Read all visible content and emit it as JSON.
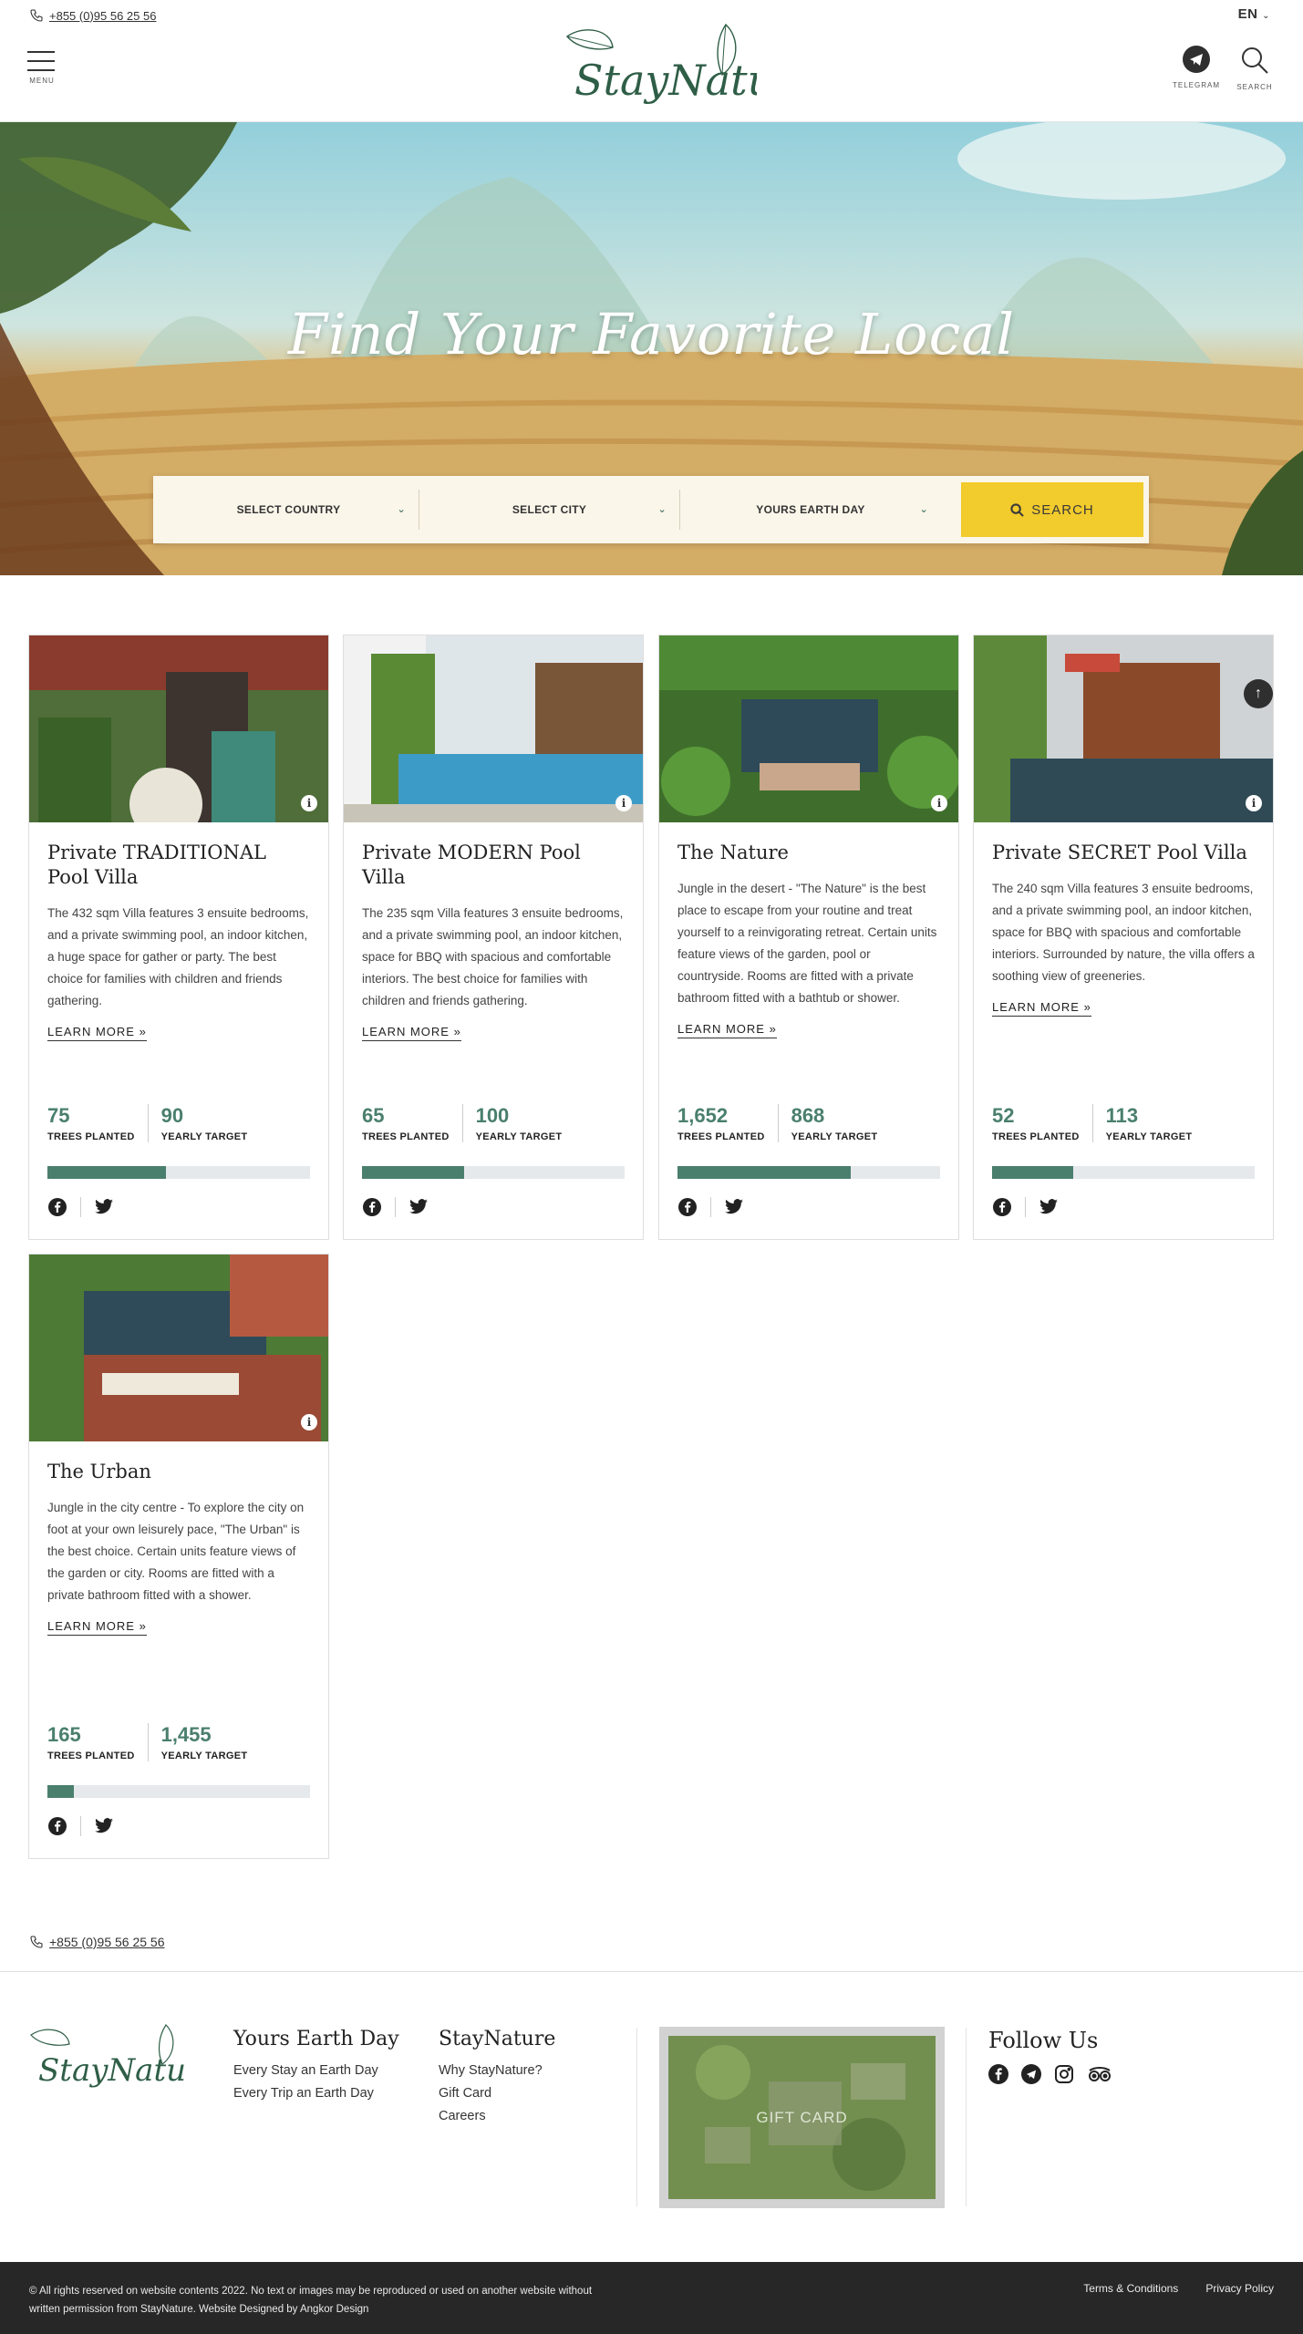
{
  "header": {
    "phone": "+855 (0)95 56 25 56",
    "language": "EN",
    "menu_label": "MENU",
    "telegram_label": "TELEGRAM",
    "search_label": "SEARCH",
    "logo_text": "StayNature"
  },
  "hero": {
    "title": "Find Your Favorite Local",
    "select_country": "SELECT COUNTRY",
    "select_city": "SELECT CITY",
    "select_day": "YOURS EARTH DAY",
    "search_button": "SEARCH"
  },
  "cards": [
    {
      "title": "Private TRADITIONAL Pool Villa",
      "description": "The 432 sqm Villa features 3 ensuite bedrooms, and a private swimming pool, an indoor kitchen, a huge space for gather or party. The best choice for families with children and friends gathering.",
      "learn_more": "LEARN MORE",
      "trees_planted": "75",
      "trees_planted_label": "TREES PLANTED",
      "yearly_target": "90",
      "yearly_target_label": "YEARLY TARGET",
      "progress": 0.45
    },
    {
      "title": "Private MODERN Pool Villa",
      "description": "The 235 sqm Villa features 3 ensuite bedrooms, and a private swimming pool, an indoor kitchen, space for BBQ with spacious and comfortable interiors. The best choice for families with children and friends gathering.",
      "learn_more": "LEARN MORE",
      "trees_planted": "65",
      "trees_planted_label": "TREES PLANTED",
      "yearly_target": "100",
      "yearly_target_label": "YEARLY TARGET",
      "progress": 0.39
    },
    {
      "title": "The Nature",
      "description": "Jungle in the desert - \"The Nature\" is the best place to escape from your routine and treat yourself to a reinvigorating retreat. Certain units feature views of the garden, pool or countryside. Rooms are fitted with a private bathroom fitted with a bathtub or shower.",
      "learn_more": "LEARN MORE",
      "trees_planted": "1,652",
      "trees_planted_label": "TREES PLANTED",
      "yearly_target": "868",
      "yearly_target_label": "YEARLY TARGET",
      "progress": 0.66
    },
    {
      "title": "Private SECRET Pool Villa",
      "description": "The 240 sqm Villa features 3 ensuite bedrooms, and a private swimming pool, an indoor kitchen, space for BBQ with spacious and comfortable interiors. Surrounded by nature, the villa offers a soothing view of greeneries.",
      "learn_more": "LEARN MORE",
      "trees_planted": "52",
      "trees_planted_label": "TREES PLANTED",
      "yearly_target": "113",
      "yearly_target_label": "YEARLY TARGET",
      "progress": 0.31
    },
    {
      "title": "The Urban",
      "description": "Jungle in the city centre - To explore the city on foot at your own leisurely pace, \"The Urban\" is the best choice. Certain units feature views of the garden or city. Rooms are fitted with a private bathroom fitted with a shower.",
      "learn_more": "LEARN MORE",
      "trees_planted": "165",
      "trees_planted_label": "TREES PLANTED",
      "yearly_target": "1,455",
      "yearly_target_label": "YEARLY TARGET",
      "progress": 0.1
    }
  ],
  "footer": {
    "phone": "+855 (0)95 56 25 56",
    "col1_title": "Yours Earth Day",
    "col1_links": [
      "Every Stay an Earth Day",
      "Every Trip an Earth Day"
    ],
    "col2_title": "StayNature",
    "col2_links": [
      "Why StayNature?",
      "Gift Card",
      "Careers"
    ],
    "gift_card_label": "GIFT CARD",
    "follow_title": "Follow Us",
    "copyright_line1": "© All rights reserved on website contents 2022. No text or images may be reproduced or used on another website without",
    "copyright_line2": "written permission from StayNature. Website Designed by Angkor Design",
    "terms": "Terms & Conditions",
    "privacy": "Privacy Policy"
  },
  "colors": {
    "accent_green": "#4a7f6e",
    "search_yellow": "#f2cb2c",
    "footer_dark": "#272727"
  }
}
